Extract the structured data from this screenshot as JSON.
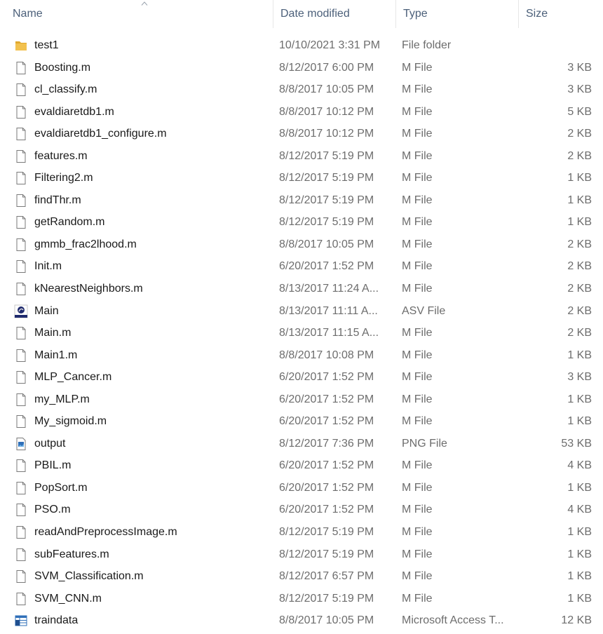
{
  "columns": {
    "name": "Name",
    "date_modified": "Date modified",
    "type": "Type",
    "size": "Size"
  },
  "files": [
    {
      "name": "test1",
      "date": "10/10/2021 3:31 PM",
      "type": "File folder",
      "size": "",
      "icon": "folder-icon"
    },
    {
      "name": "Boosting.m",
      "date": "8/12/2017 6:00 PM",
      "type": "M File",
      "size": "3 KB",
      "icon": "file-icon"
    },
    {
      "name": "cl_classify.m",
      "date": "8/8/2017 10:05 PM",
      "type": "M File",
      "size": "3 KB",
      "icon": "file-icon"
    },
    {
      "name": "evaldiaretdb1.m",
      "date": "8/8/2017 10:12 PM",
      "type": "M File",
      "size": "5 KB",
      "icon": "file-icon"
    },
    {
      "name": "evaldiaretdb1_configure.m",
      "date": "8/8/2017 10:12 PM",
      "type": "M File",
      "size": "2 KB",
      "icon": "file-icon"
    },
    {
      "name": "features.m",
      "date": "8/12/2017 5:19 PM",
      "type": "M File",
      "size": "2 KB",
      "icon": "file-icon"
    },
    {
      "name": "Filtering2.m",
      "date": "8/12/2017 5:19 PM",
      "type": "M File",
      "size": "1 KB",
      "icon": "file-icon"
    },
    {
      "name": "findThr.m",
      "date": "8/12/2017 5:19 PM",
      "type": "M File",
      "size": "1 KB",
      "icon": "file-icon"
    },
    {
      "name": "getRandom.m",
      "date": "8/12/2017 5:19 PM",
      "type": "M File",
      "size": "1 KB",
      "icon": "file-icon"
    },
    {
      "name": "gmmb_frac2lhood.m",
      "date": "8/8/2017 10:05 PM",
      "type": "M File",
      "size": "2 KB",
      "icon": "file-icon"
    },
    {
      "name": "Init.m",
      "date": "6/20/2017 1:52 PM",
      "type": "M File",
      "size": "2 KB",
      "icon": "file-icon"
    },
    {
      "name": "kNearestNeighbors.m",
      "date": "8/13/2017 11:24 A...",
      "type": "M File",
      "size": "2 KB",
      "icon": "file-icon"
    },
    {
      "name": "Main",
      "date": "8/13/2017 11:11 A...",
      "type": "ASV File",
      "size": "2 KB",
      "icon": "asv-file-icon"
    },
    {
      "name": "Main.m",
      "date": "8/13/2017 11:15 A...",
      "type": "M File",
      "size": "2 KB",
      "icon": "file-icon"
    },
    {
      "name": "Main1.m",
      "date": "8/8/2017 10:08 PM",
      "type": "M File",
      "size": "1 KB",
      "icon": "file-icon"
    },
    {
      "name": "MLP_Cancer.m",
      "date": "6/20/2017 1:52 PM",
      "type": "M File",
      "size": "3 KB",
      "icon": "file-icon"
    },
    {
      "name": "my_MLP.m",
      "date": "6/20/2017 1:52 PM",
      "type": "M File",
      "size": "1 KB",
      "icon": "file-icon"
    },
    {
      "name": "My_sigmoid.m",
      "date": "6/20/2017 1:52 PM",
      "type": "M File",
      "size": "1 KB",
      "icon": "file-icon"
    },
    {
      "name": "output",
      "date": "8/12/2017 7:36 PM",
      "type": "PNG File",
      "size": "53 KB",
      "icon": "image-file-icon"
    },
    {
      "name": "PBIL.m",
      "date": "6/20/2017 1:52 PM",
      "type": "M File",
      "size": "4 KB",
      "icon": "file-icon"
    },
    {
      "name": "PopSort.m",
      "date": "6/20/2017 1:52 PM",
      "type": "M File",
      "size": "1 KB",
      "icon": "file-icon"
    },
    {
      "name": "PSO.m",
      "date": "6/20/2017 1:52 PM",
      "type": "M File",
      "size": "4 KB",
      "icon": "file-icon"
    },
    {
      "name": "readAndPreprocessImage.m",
      "date": "8/12/2017 5:19 PM",
      "type": "M File",
      "size": "1 KB",
      "icon": "file-icon"
    },
    {
      "name": "subFeatures.m",
      "date": "8/12/2017 5:19 PM",
      "type": "M File",
      "size": "1 KB",
      "icon": "file-icon"
    },
    {
      "name": "SVM_Classification.m",
      "date": "8/12/2017 6:57 PM",
      "type": "M File",
      "size": "1 KB",
      "icon": "file-icon"
    },
    {
      "name": "SVM_CNN.m",
      "date": "8/12/2017 5:19 PM",
      "type": "M File",
      "size": "1 KB",
      "icon": "file-icon"
    },
    {
      "name": "traindata",
      "date": "8/8/2017 10:05 PM",
      "type": "Microsoft Access T...",
      "size": "12 KB",
      "icon": "access-table-icon"
    }
  ],
  "colors": {
    "header_text": "#4c607a",
    "name_text": "#1a1a1a",
    "detail_text": "#6d6d6d",
    "folder": "#f2c14e"
  }
}
